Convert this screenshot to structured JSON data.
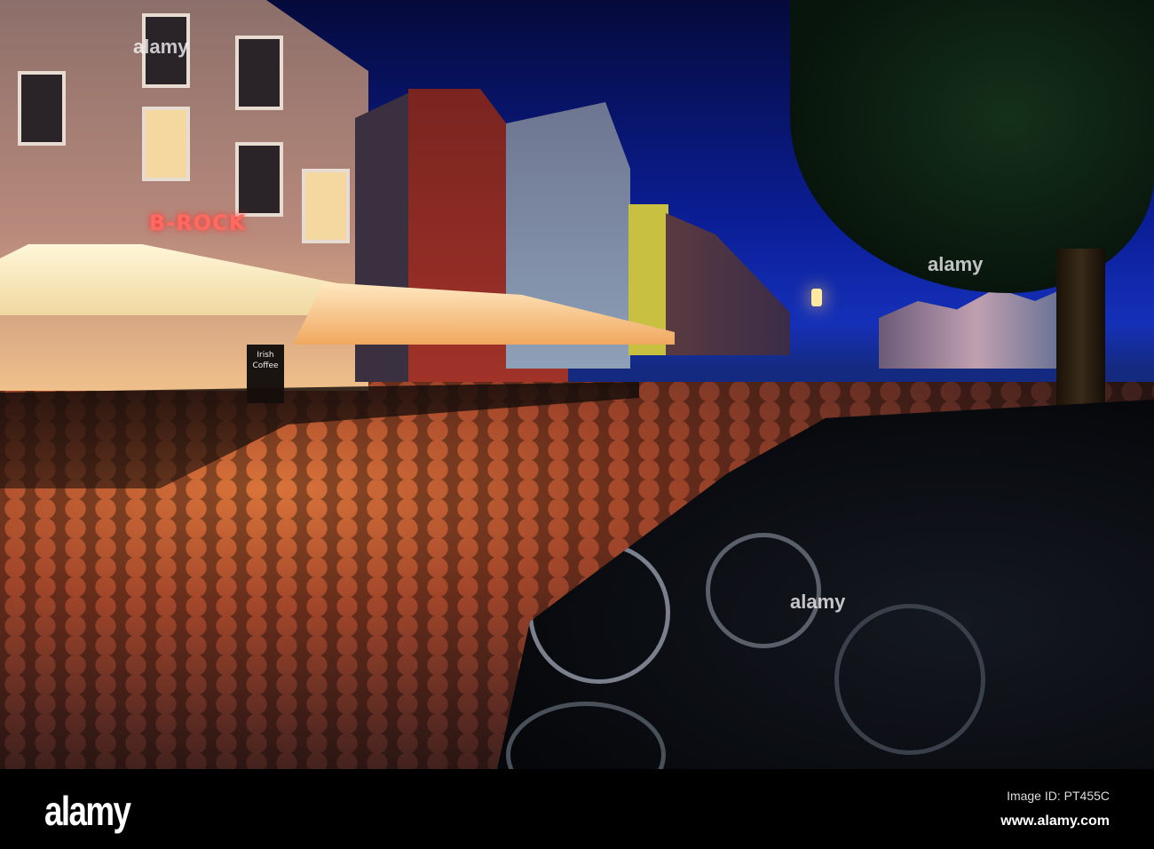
{
  "photo": {
    "signs": {
      "restaurant": "B-ROCK",
      "menu_board": "Irish Coffee"
    },
    "watermarks": [
      "alamy",
      "alamy",
      "alamy"
    ]
  },
  "footer": {
    "logo": "alamy",
    "image_id": "Image ID: PT455C",
    "url": "www.alamy.com"
  }
}
